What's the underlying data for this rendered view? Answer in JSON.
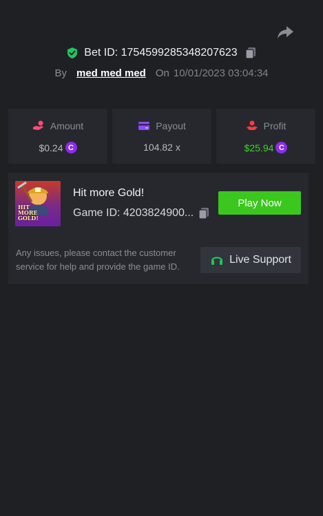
{
  "header": {
    "bet_id_label": "Bet ID: 1754599285348207623",
    "by_label": "By",
    "username": "med med med",
    "on_label": "On",
    "timestamp": "10/01/2023 03:04:34"
  },
  "stats": {
    "amount": {
      "label": "Amount",
      "value": "$0.24",
      "coin": "C"
    },
    "payout": {
      "label": "Payout",
      "value": "104.82 x"
    },
    "profit": {
      "label": "Profit",
      "value": "$25.94",
      "coin": "C"
    }
  },
  "game": {
    "name": "Hit more Gold!",
    "id_label": "Game ID: 4203824900...",
    "thumb_title": "HIT MORE GOLD!",
    "play_label": "Play Now"
  },
  "support": {
    "message": "Any issues, please contact the customer service for help and provide the game ID.",
    "button_label": "Live Support"
  },
  "colors": {
    "background": "#1f2024",
    "card": "#26282d",
    "accent_green": "#3bc71e",
    "coin_purple": "#8a2cf0"
  },
  "icons": [
    "share-icon",
    "shield-check-icon",
    "copy-icon",
    "hand-coin-icon",
    "card-icon",
    "hand-profit-icon",
    "headset-icon"
  ]
}
